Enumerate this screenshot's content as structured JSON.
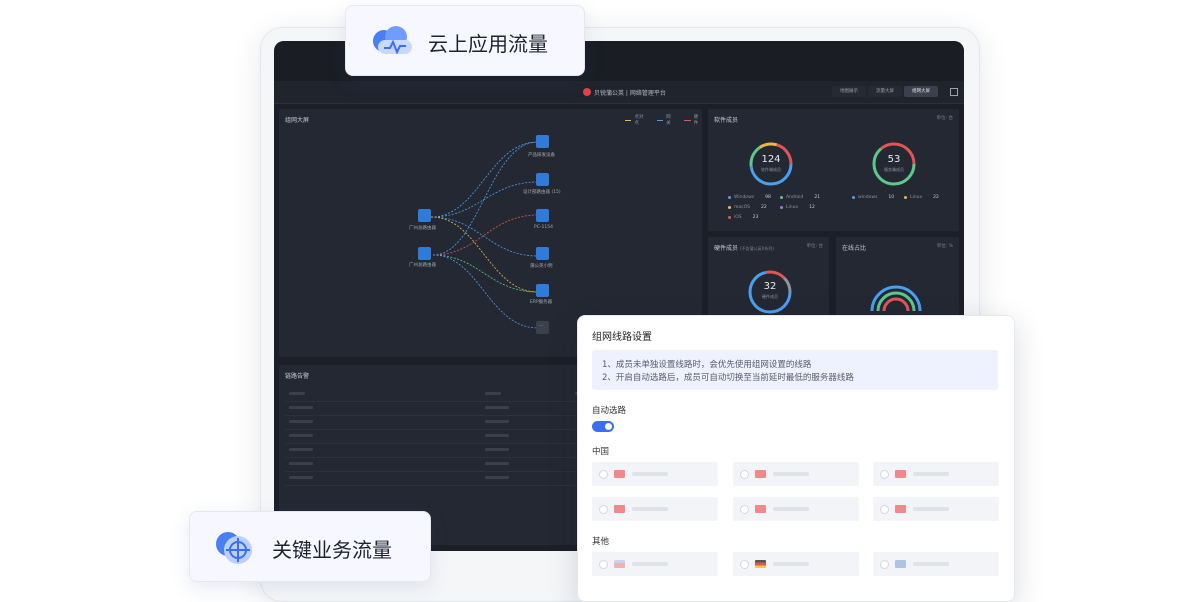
{
  "top_badge": {
    "label": "云上应用流量",
    "icon": "cloud-pulse-icon"
  },
  "bottom_badge": {
    "label": "关键业务流量",
    "icon": "globe-crosshair-icon"
  },
  "app": {
    "brand": "贝锐蒲公英 | 网络管理平台",
    "tabs": [
      "地图展示",
      "流量大屏",
      "组网大屏"
    ],
    "active_tab": "组网大屏"
  },
  "topology": {
    "title": "组网大屏",
    "legend": [
      "点对点",
      "网关",
      "硬件"
    ],
    "legend_colors": [
      "#e8b84a",
      "#4a9ff0",
      "#e05656"
    ],
    "sources": [
      "广州总路由器",
      "广州总路由器"
    ],
    "targets": [
      "产品研发设备",
      "设计部路由器",
      "PC-1154",
      "蒲公英小明",
      "ERP服务器",
      "..."
    ],
    "target_extra": "(15)"
  },
  "software": {
    "title": "软件成员",
    "unit": "单位: 台",
    "donut1": {
      "value": "124",
      "sub": "软件端成员"
    },
    "donut2": {
      "value": "53",
      "sub": "服务端成员"
    },
    "stats": [
      {
        "name": "Windows",
        "value": "98",
        "color": "#4a9ff0"
      },
      {
        "name": "Android",
        "value": "21",
        "color": "#5cc98a"
      },
      {
        "name": "macOS",
        "value": "22",
        "color": "#e8b84a"
      },
      {
        "name": "Linux",
        "value": "12",
        "color": "#9a7bf0"
      },
      {
        "name": "iOS",
        "value": "23",
        "color": "#e05656"
      }
    ],
    "stats2": [
      {
        "name": "windows",
        "value": "10",
        "color": "#4a9ff0"
      },
      {
        "name": "Linux",
        "value": "22",
        "color": "#e8b84a"
      }
    ]
  },
  "hardware": {
    "title": "硬件成员",
    "note": "(不含蒲公英X系列)",
    "unit": "单位: 台",
    "donut": {
      "value": "32",
      "sub": "硬件成员"
    }
  },
  "online": {
    "title": "在线占比",
    "unit": "单位: %"
  },
  "alerts": {
    "title": "链路告警"
  },
  "dialog": {
    "title": "组网线路设置",
    "notice": [
      "1、成员未单独设置线路时，会优先使用组网设置的线路",
      "2、开启自动选路后，成员可自动切换至当前延时最低的服务器线路"
    ],
    "auto_route_label": "自动选路",
    "auto_route_on": true,
    "china_label": "中国",
    "other_label": "其他"
  }
}
